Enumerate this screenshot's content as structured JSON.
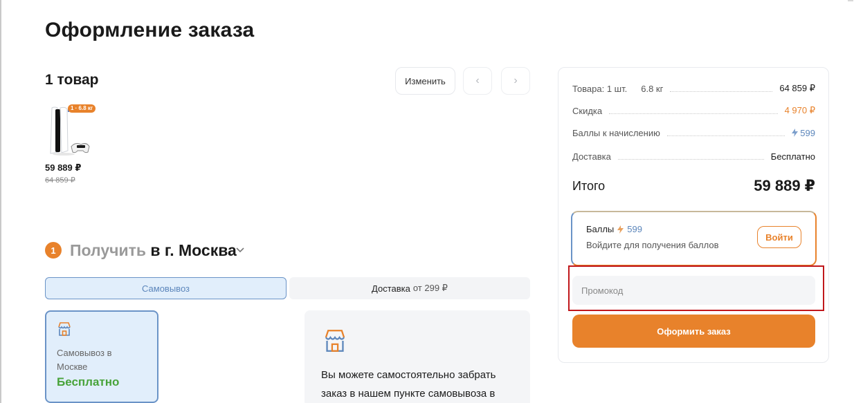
{
  "page": {
    "title": "Оформление заказа"
  },
  "cart": {
    "title": "1 товар",
    "edit_label": "Изменить",
    "prev_icon": "chevron-left-icon",
    "next_icon": "chevron-right-icon",
    "product": {
      "image": "console-icon",
      "weight_badge": "1 · 6.8 кг",
      "price": "59 889 ₽",
      "old_price": "64 859 ₽"
    }
  },
  "receive": {
    "step": "1",
    "title": "Получить",
    "city": "в г. Москва",
    "tabs": {
      "pickup": "Самовывоз",
      "delivery": "Доставка",
      "delivery_price": "от 299 ₽"
    },
    "pickup_option": {
      "icon": "store-icon",
      "title": "Самовывоз в Москве",
      "price": "Бесплатно"
    },
    "info": {
      "icon": "store-icon",
      "text": "Вы можете самостоятельно забрать заказ в нашем пункте самовывоза в"
    }
  },
  "summary": {
    "goods_label": "Товара: 1 шт.",
    "goods_weight": "6.8 кг",
    "goods_value": "64 859 ₽",
    "discount_label": "Скидка",
    "discount_value": "4 970 ₽",
    "bonus_label": "Баллы к начислению",
    "bonus_value": "599",
    "delivery_label": "Доставка",
    "delivery_value": "Бесплатно",
    "total_label": "Итого",
    "total_value": "59 889 ₽",
    "points": {
      "label": "Баллы",
      "value": "599",
      "subtitle": "Войдите для получения баллов",
      "login_label": "Войти"
    },
    "promo_placeholder": "Промокод",
    "order_label": "Оформить заказ"
  },
  "colors": {
    "accent": "#e8822b",
    "blue": "#5c86bb",
    "green": "#48a33a",
    "highlight": "#c0171b"
  }
}
